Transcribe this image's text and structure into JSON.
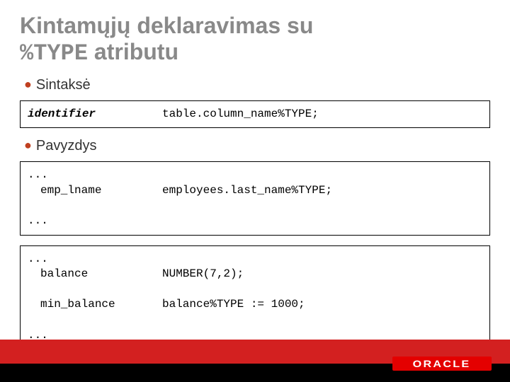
{
  "title": {
    "line1": "Kintamųjų deklaravimas su",
    "code": "%TYPE",
    "line2_rest": " atributu"
  },
  "bullets": {
    "syntax": "Sintaksė",
    "example": "Pavyzdys"
  },
  "box1": {
    "left": "identifier",
    "right": "table.column_name%TYPE;"
  },
  "box2": {
    "dots1": "...",
    "var": "emp_lname",
    "decl": "employees.last_name%TYPE;",
    "dots2": "..."
  },
  "box3": {
    "dots1": "...",
    "var1": "balance",
    "decl1": "NUMBER(7,2);",
    "var2": "min_balance",
    "decl2": "balance%TYPE := 1000;",
    "dots2": "..."
  },
  "logo": "ORACLE"
}
